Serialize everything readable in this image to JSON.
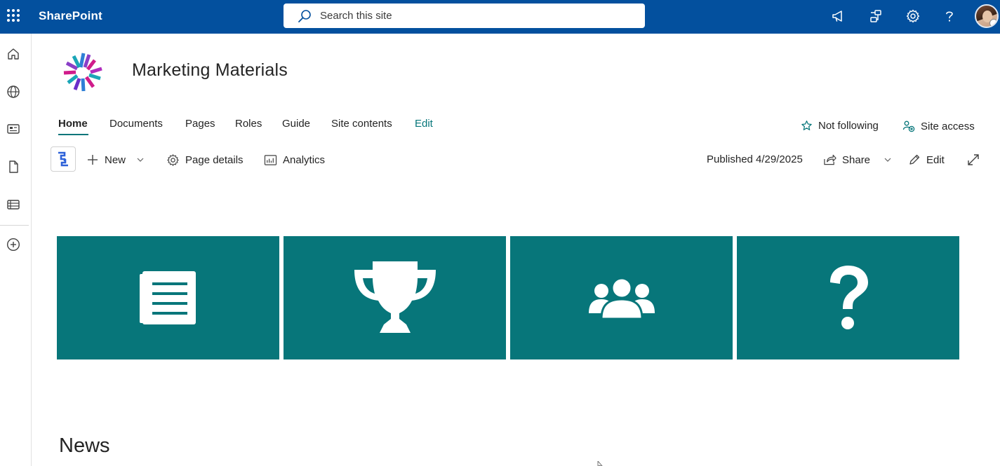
{
  "suite_bar": {
    "app_name": "SharePoint",
    "search_placeholder": "Search this site",
    "icons": [
      "app-launcher-icon",
      "megaphone-icon",
      "network-icon",
      "settings-gear-icon",
      "help-icon",
      "user-avatar"
    ]
  },
  "left_rail": {
    "icons": [
      "home-icon",
      "globe-icon",
      "news-icon",
      "document-icon",
      "list-icon",
      "create-plus-icon"
    ]
  },
  "site": {
    "title": "Marketing Materials",
    "nav": [
      "Home",
      "Documents",
      "Pages",
      "Roles",
      "Guide",
      "Site contents",
      "Edit"
    ],
    "active_nav": "Home",
    "follow_label": "Not following",
    "access_label": "Site access"
  },
  "command_bar": {
    "new_label": "New",
    "page_details_label": "Page details",
    "analytics_label": "Analytics",
    "published_label": "Published 4/29/2025",
    "share_label": "Share",
    "edit_label": "Edit"
  },
  "tiles": [
    {
      "icon": "newspaper-icon"
    },
    {
      "icon": "trophy-icon"
    },
    {
      "icon": "group-icon"
    },
    {
      "icon": "question-mark-icon"
    }
  ],
  "sections": {
    "news_heading": "News"
  },
  "colors": {
    "suite_bar": "#03509e",
    "accent_teal": "#07767a",
    "tile_bg": "#07767a"
  }
}
